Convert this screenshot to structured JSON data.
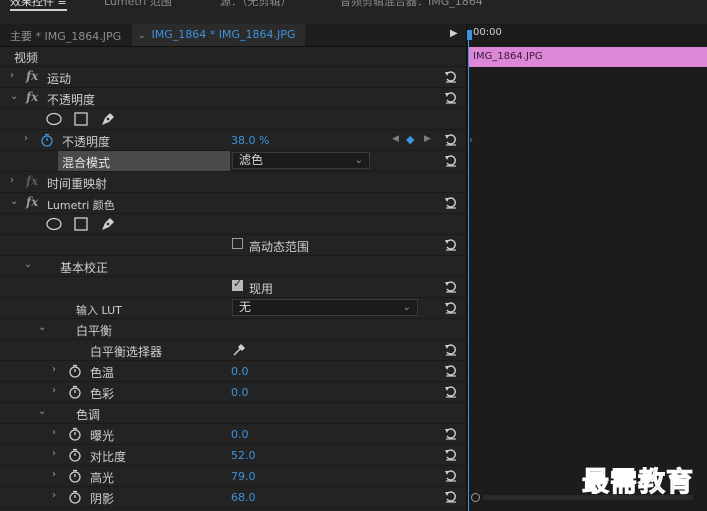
{
  "top_tabs": [
    "效果控件 ≡",
    "Lumetri 范围",
    "源：（无剪辑）",
    "音频剪辑混合器：IMG_1864"
  ],
  "source_bar": {
    "master_label": "主要 * IMG_1864.JPG",
    "clip_label": "IMG_1864 * IMG_1864.JPG"
  },
  "timeline": {
    "time_label": "00:00",
    "clip_name": "IMG_1864.JPG",
    "playhead_color": "#3d93e0",
    "clip_color": "#dc87d8"
  },
  "effects": {
    "video_header": "视频",
    "motion": "运动",
    "opacity": "不透明度",
    "opacity_param": "不透明度",
    "opacity_value": "38.0 %",
    "blend_label": "混合模式",
    "blend_value": "滤色",
    "time_remap": "时间重映射",
    "lumetri": "Lumetri 颜色",
    "hdr_label": "高动态范围",
    "basic_correction": "基本校正",
    "enable_label": "现用",
    "input_lut_label": "输入 LUT",
    "input_lut_value": "无",
    "white_balance": "白平衡",
    "wb_picker": "白平衡选择器",
    "temperature_label": "色温",
    "temperature_value": "0.0",
    "tint_label": "色彩",
    "tint_value": "0.0",
    "tone": "色调",
    "exposure_label": "曝光",
    "exposure_value": "0.0",
    "contrast_label": "对比度",
    "contrast_value": "52.0",
    "highlights_label": "高光",
    "highlights_value": "79.0",
    "shadows_label": "阴影",
    "shadows_value": "68.0"
  },
  "watermark": "最需教育",
  "colors": {
    "accent": "#3d93e0",
    "panel": "#232323",
    "clip": "#dc87d8"
  }
}
